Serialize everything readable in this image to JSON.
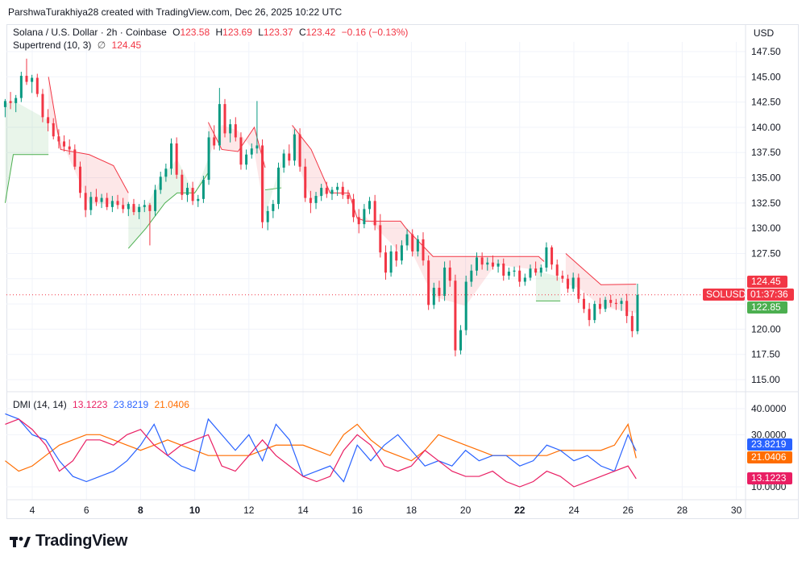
{
  "header": {
    "credit": "ParshwaTurakhiya28 created with TradingView.com, Dec 26, 2025 10:22 UTC"
  },
  "price_legend": {
    "symbol": "Solana / U.S. Dollar · 2h · Coinbase",
    "o_label": "O",
    "o_value": "123.58",
    "h_label": "H",
    "h_value": "123.69",
    "l_label": "L",
    "l_value": "123.37",
    "c_label": "C",
    "c_value": "123.42",
    "change": "−0.16 (−0.13%)",
    "indicator": "Supertrend (10, 3)",
    "indicator_icon": "∅",
    "indicator_value": "124.45"
  },
  "dmi_legend": {
    "name": "DMI (14, 14)",
    "minus_di": "13.1223",
    "plus_di": "23.8219",
    "adx": "21.0406"
  },
  "currency_label": "USD",
  "price_axis": {
    "ticks": [
      "147.50",
      "145.00",
      "142.50",
      "140.00",
      "137.50",
      "135.00",
      "132.50",
      "130.00",
      "127.50",
      "125.00",
      "122.50",
      "120.00",
      "117.50",
      "115.00"
    ],
    "badge_supertrend": "124.45",
    "badge_symbol": "SOLUSD",
    "badge_countdown": "01:37:36",
    "badge_last": "122.85"
  },
  "dmi_axis": {
    "ticks": [
      "40.0000",
      "30.0000",
      "10.0000"
    ],
    "badge_plus": "23.8219",
    "badge_adx": "21.0406",
    "badge_minus": "13.1223"
  },
  "time_axis": {
    "ticks": [
      "4",
      "6",
      "8",
      "10",
      "12",
      "14",
      "16",
      "18",
      "20",
      "22",
      "24",
      "26",
      "28",
      "30"
    ],
    "bold": [
      "8",
      "10",
      "22"
    ]
  },
  "colors": {
    "up": "#089981",
    "down": "#f23645",
    "supertrend_up": "#4caf50",
    "supertrend_down": "#f23645",
    "plus_di": "#2962ff",
    "minus_di": "#e91e63",
    "adx": "#ff6d00",
    "grid": "#f0f3fa"
  },
  "brand": {
    "name": "TradingView",
    "icon": "tradingview-logo-icon"
  },
  "chart_data": {
    "type": "candlestick",
    "symbol": "SOLUSD",
    "interval": "2h",
    "x_start_day": 3,
    "x_step_day": 0.0833,
    "ylim": [
      114.0,
      149.0
    ],
    "candles": [
      [
        142.0,
        142.8,
        141.0,
        142.6
      ],
      [
        142.6,
        143.5,
        141.8,
        142.4
      ],
      [
        142.4,
        143.2,
        141.5,
        142.9
      ],
      [
        142.9,
        145.5,
        142.5,
        145.1
      ],
      [
        145.1,
        146.8,
        144.2,
        144.5
      ],
      [
        144.5,
        145.2,
        143.4,
        144.9
      ],
      [
        144.9,
        145.3,
        143.0,
        143.3
      ],
      [
        143.3,
        143.8,
        140.5,
        141.0
      ],
      [
        141.0,
        141.8,
        139.6,
        140.4
      ],
      [
        140.4,
        140.9,
        138.8,
        139.1
      ],
      [
        139.1,
        139.8,
        137.9,
        138.6
      ],
      [
        138.6,
        139.2,
        137.6,
        138.1
      ],
      [
        138.1,
        138.8,
        137.3,
        137.8
      ],
      [
        137.8,
        138.3,
        135.8,
        136.1
      ],
      [
        136.1,
        136.6,
        133.0,
        133.5
      ],
      [
        133.5,
        134.2,
        131.1,
        131.8
      ],
      [
        131.8,
        133.6,
        131.3,
        133.1
      ],
      [
        133.1,
        133.9,
        132.2,
        132.6
      ],
      [
        132.6,
        133.4,
        132.0,
        133.0
      ],
      [
        133.0,
        133.5,
        131.8,
        132.1
      ],
      [
        132.1,
        133.2,
        131.6,
        132.7
      ],
      [
        132.7,
        133.3,
        131.9,
        132.3
      ],
      [
        132.3,
        133.0,
        131.5,
        131.9
      ],
      [
        131.9,
        132.6,
        131.2,
        132.4
      ],
      [
        132.4,
        132.9,
        131.3,
        131.6
      ],
      [
        131.6,
        132.4,
        130.9,
        132.1
      ],
      [
        132.1,
        132.8,
        131.6,
        132.3
      ],
      [
        132.3,
        132.5,
        128.3,
        131.7
      ],
      [
        131.7,
        134.3,
        131.2,
        133.8
      ],
      [
        133.8,
        135.6,
        133.4,
        135.1
      ],
      [
        135.1,
        136.4,
        134.6,
        135.9
      ],
      [
        135.9,
        138.9,
        135.3,
        138.4
      ],
      [
        138.4,
        139.0,
        134.9,
        135.3
      ],
      [
        135.3,
        135.8,
        132.8,
        133.3
      ],
      [
        133.3,
        134.5,
        132.6,
        134.0
      ],
      [
        134.0,
        134.6,
        132.3,
        132.7
      ],
      [
        132.7,
        133.3,
        132.1,
        132.9
      ],
      [
        132.9,
        135.2,
        132.5,
        134.8
      ],
      [
        134.8,
        139.6,
        134.3,
        139.0
      ],
      [
        139.0,
        140.2,
        137.8,
        138.2
      ],
      [
        138.2,
        143.9,
        137.7,
        142.3
      ],
      [
        142.3,
        142.8,
        139.0,
        139.4
      ],
      [
        139.4,
        140.8,
        138.5,
        140.3
      ],
      [
        140.3,
        141.0,
        138.6,
        139.0
      ],
      [
        139.0,
        139.5,
        135.8,
        136.3
      ],
      [
        136.3,
        137.8,
        135.8,
        137.3
      ],
      [
        137.3,
        138.4,
        136.9,
        137.9
      ],
      [
        137.9,
        142.6,
        137.4,
        138.2
      ],
      [
        138.2,
        138.8,
        130.0,
        130.6
      ],
      [
        130.6,
        132.2,
        129.8,
        131.7
      ],
      [
        131.7,
        132.8,
        131.0,
        132.4
      ],
      [
        132.4,
        136.5,
        131.9,
        136.0
      ],
      [
        136.0,
        137.8,
        135.5,
        137.4
      ],
      [
        137.4,
        138.3,
        136.2,
        136.7
      ],
      [
        136.7,
        139.8,
        136.2,
        139.3
      ],
      [
        139.3,
        139.9,
        135.6,
        136.1
      ],
      [
        136.1,
        136.9,
        132.6,
        133.0
      ],
      [
        133.0,
        133.7,
        131.5,
        132.5
      ],
      [
        132.5,
        133.6,
        131.9,
        133.2
      ],
      [
        133.2,
        134.4,
        132.7,
        134.0
      ],
      [
        134.0,
        134.6,
        133.0,
        133.4
      ],
      [
        133.4,
        134.1,
        132.8,
        133.8
      ],
      [
        133.8,
        134.5,
        133.2,
        134.1
      ],
      [
        134.1,
        134.6,
        132.9,
        133.3
      ],
      [
        133.3,
        133.8,
        132.4,
        132.9
      ],
      [
        132.9,
        133.4,
        130.6,
        131.1
      ],
      [
        131.1,
        131.9,
        129.5,
        130.4
      ],
      [
        130.4,
        132.4,
        130.0,
        131.9
      ],
      [
        131.9,
        133.1,
        131.4,
        132.7
      ],
      [
        132.7,
        133.3,
        129.8,
        130.3
      ],
      [
        130.3,
        131.4,
        127.1,
        127.6
      ],
      [
        127.6,
        128.3,
        124.9,
        125.6
      ],
      [
        125.6,
        128.3,
        125.2,
        127.7
      ],
      [
        127.7,
        128.4,
        126.2,
        126.8
      ],
      [
        126.8,
        128.8,
        126.4,
        128.3
      ],
      [
        128.3,
        129.9,
        127.8,
        129.4
      ],
      [
        129.4,
        129.9,
        127.2,
        127.7
      ],
      [
        127.7,
        129.3,
        127.2,
        128.9
      ],
      [
        128.9,
        129.6,
        126.3,
        126.8
      ],
      [
        126.8,
        127.3,
        121.9,
        122.4
      ],
      [
        122.4,
        124.6,
        122.0,
        124.1
      ],
      [
        124.1,
        124.8,
        122.7,
        123.3
      ],
      [
        123.3,
        126.7,
        122.8,
        126.1
      ],
      [
        126.1,
        126.8,
        124.2,
        124.8
      ],
      [
        124.8,
        125.4,
        117.3,
        117.9
      ],
      [
        117.9,
        120.4,
        117.5,
        119.9
      ],
      [
        119.9,
        125.3,
        119.4,
        124.7
      ],
      [
        124.7,
        126.4,
        124.2,
        125.8
      ],
      [
        125.8,
        127.6,
        125.3,
        127.1
      ],
      [
        127.1,
        127.6,
        125.9,
        126.4
      ],
      [
        126.4,
        127.1,
        125.8,
        126.6
      ],
      [
        126.6,
        127.3,
        125.9,
        126.2
      ],
      [
        126.2,
        126.9,
        125.6,
        126.5
      ],
      [
        126.5,
        127.0,
        124.8,
        125.3
      ],
      [
        125.3,
        126.1,
        124.9,
        125.7
      ],
      [
        125.7,
        126.2,
        125.2,
        125.8
      ],
      [
        125.8,
        126.3,
        124.2,
        124.7
      ],
      [
        124.7,
        125.5,
        124.3,
        125.1
      ],
      [
        125.1,
        126.4,
        124.8,
        126.0
      ],
      [
        126.0,
        126.7,
        125.3,
        125.6
      ],
      [
        125.6,
        126.4,
        125.2,
        126.1
      ],
      [
        126.1,
        128.6,
        125.7,
        128.1
      ],
      [
        128.1,
        128.3,
        125.9,
        126.4
      ],
      [
        126.4,
        126.9,
        124.8,
        125.3
      ],
      [
        125.3,
        125.8,
        124.6,
        125.0
      ],
      [
        125.0,
        125.4,
        123.6,
        124.0
      ],
      [
        124.0,
        125.6,
        123.7,
        125.1
      ],
      [
        125.1,
        125.5,
        122.6,
        123.0
      ],
      [
        123.0,
        123.6,
        121.6,
        122.0
      ],
      [
        122.0,
        122.6,
        120.3,
        120.9
      ],
      [
        120.9,
        122.8,
        120.6,
        122.5
      ],
      [
        122.5,
        123.1,
        121.5,
        122.0
      ],
      [
        122.0,
        123.2,
        121.7,
        122.9
      ],
      [
        122.9,
        123.4,
        122.2,
        122.6
      ],
      [
        122.6,
        123.0,
        121.9,
        122.5
      ],
      [
        122.5,
        123.1,
        121.8,
        122.8
      ],
      [
        122.8,
        123.5,
        120.6,
        121.3
      ],
      [
        121.3,
        121.8,
        119.2,
        119.8
      ],
      [
        119.8,
        124.5,
        119.5,
        123.4
      ]
    ],
    "supertrend": {
      "indicator": "Supertrend (10, 3)",
      "segments": [
        {
          "trend": "up",
          "points": [
            [
              3.0,
              132.5
            ],
            [
              3.3,
              137.3
            ],
            [
              4.6,
              137.3
            ]
          ]
        },
        {
          "trend": "down",
          "points": [
            [
              4.6,
              145.0
            ],
            [
              5.05,
              137.8
            ],
            [
              6.1,
              137.3
            ],
            [
              7.0,
              136.2
            ],
            [
              7.55,
              133.5
            ]
          ]
        },
        {
          "trend": "up",
          "points": [
            [
              7.55,
              128.0
            ],
            [
              8.2,
              130.0
            ],
            [
              8.9,
              132.5
            ],
            [
              9.35,
              133.5
            ],
            [
              10.0,
              133.5
            ],
            [
              10.5,
              135.5
            ]
          ]
        },
        {
          "trend": "down",
          "points": [
            [
              10.5,
              140.5
            ],
            [
              11.0,
              137.8
            ],
            [
              11.6,
              137.6
            ],
            [
              12.2,
              140.0
            ],
            [
              12.6,
              136.0
            ]
          ]
        },
        {
          "trend": "up",
          "points": [
            [
              12.6,
              133.8
            ],
            [
              13.2,
              134.0
            ]
          ]
        },
        {
          "trend": "down",
          "points": [
            [
              13.6,
              140.2
            ],
            [
              14.3,
              137.8
            ],
            [
              15.0,
              133.5
            ],
            [
              15.7,
              133.5
            ],
            [
              16.0,
              131.0
            ],
            [
              16.3,
              130.7
            ],
            [
              17.6,
              130.7
            ],
            [
              17.8,
              130.0
            ],
            [
              18.8,
              127.2
            ],
            [
              20.0,
              127.2
            ],
            [
              21.1,
              127.2
            ],
            [
              22.7,
              127.2
            ],
            [
              22.9,
              126.7
            ]
          ]
        },
        {
          "trend": "up",
          "points": [
            [
              22.6,
              122.8
            ],
            [
              23.5,
              122.8
            ]
          ]
        },
        {
          "trend": "down",
          "points": [
            [
              23.7,
              127.5
            ],
            [
              24.2,
              126.3
            ],
            [
              25.0,
              124.4
            ],
            [
              26.3,
              124.45
            ]
          ]
        }
      ]
    },
    "dmi": {
      "x_days": [
        3.0,
        3.5,
        4.0,
        4.5,
        5.0,
        5.5,
        6.0,
        6.5,
        7.0,
        7.5,
        8.0,
        8.5,
        9.0,
        9.5,
        10.0,
        10.5,
        11.0,
        11.5,
        12.0,
        12.5,
        13.0,
        13.5,
        14.0,
        14.5,
        15.0,
        15.5,
        16.0,
        16.5,
        17.0,
        17.5,
        18.0,
        18.5,
        19.0,
        19.5,
        20.0,
        20.5,
        21.0,
        21.5,
        22.0,
        22.5,
        23.0,
        23.5,
        24.0,
        24.5,
        25.0,
        25.5,
        26.0,
        26.3
      ],
      "plus_di": [
        38,
        36,
        30,
        28,
        20,
        14,
        12,
        14,
        16,
        20,
        26,
        34,
        22,
        18,
        16,
        36,
        30,
        24,
        30,
        20,
        34,
        28,
        14,
        16,
        18,
        12,
        26,
        20,
        26,
        30,
        24,
        18,
        20,
        18,
        24,
        20,
        22,
        22,
        18,
        20,
        26,
        24,
        20,
        22,
        18,
        16,
        30,
        23.8
      ],
      "minus_di": [
        34,
        36,
        32,
        26,
        16,
        20,
        28,
        28,
        26,
        30,
        32,
        26,
        22,
        26,
        28,
        30,
        18,
        16,
        22,
        28,
        22,
        18,
        14,
        12,
        14,
        24,
        30,
        26,
        18,
        16,
        18,
        24,
        20,
        16,
        14,
        14,
        16,
        12,
        10,
        12,
        16,
        14,
        10,
        12,
        14,
        16,
        18,
        13.1
      ],
      "adx": [
        20,
        16,
        18,
        22,
        26,
        28,
        30,
        30,
        28,
        26,
        24,
        26,
        28,
        26,
        24,
        22,
        22,
        22,
        22,
        24,
        26,
        26,
        26,
        24,
        22,
        30,
        34,
        28,
        24,
        22,
        20,
        24,
        30,
        28,
        26,
        24,
        22,
        22,
        22,
        22,
        22,
        24,
        24,
        24,
        24,
        26,
        34,
        21.0
      ]
    }
  }
}
